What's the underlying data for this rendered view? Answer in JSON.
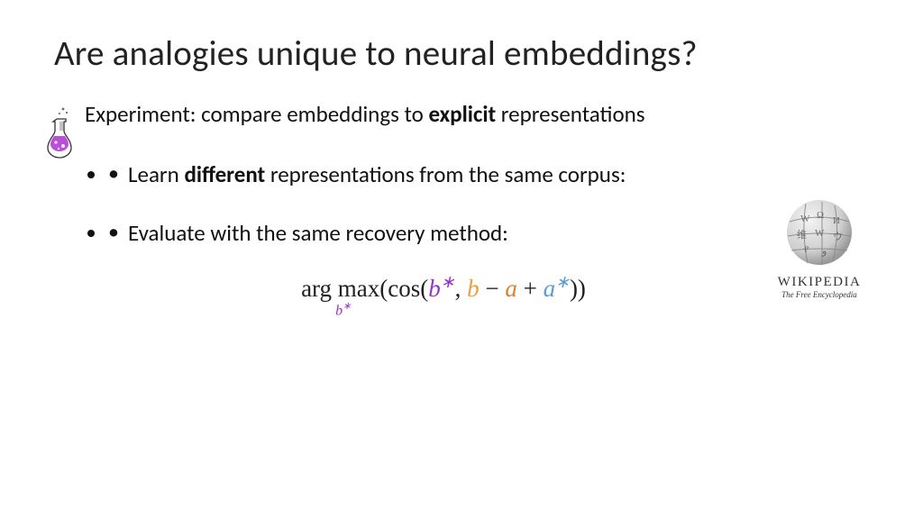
{
  "title": "Are analogies unique to neural embeddings?",
  "subtitle_prefix": "Experiment: compare embeddings to ",
  "subtitle_bold": "explicit",
  "subtitle_suffix": " representations",
  "bullets": [
    {
      "prefix": "Learn ",
      "bold": "different",
      "suffix": " representations from the same corpus:"
    },
    {
      "prefix": "Evaluate with the same recovery method:",
      "bold": "",
      "suffix": ""
    }
  ],
  "formula": {
    "argmax": "arg max",
    "under_var": "b",
    "under_sup": "∗",
    "lparen_cos": "(cos(",
    "b": "b",
    "b_sup": "∗",
    "comma": ", ",
    "bb": "b",
    "minus": " − ",
    "a": "a",
    "plus": " + ",
    "aa": "a",
    "aa_sup": "∗",
    "rparen": "))"
  },
  "wiki": {
    "wordmark": "WIKIPEDIA",
    "tagline": "The Free Encyclopedia"
  },
  "icons": {
    "flask": "flask-icon",
    "wiki_globe": "wikipedia-globe-icon"
  }
}
